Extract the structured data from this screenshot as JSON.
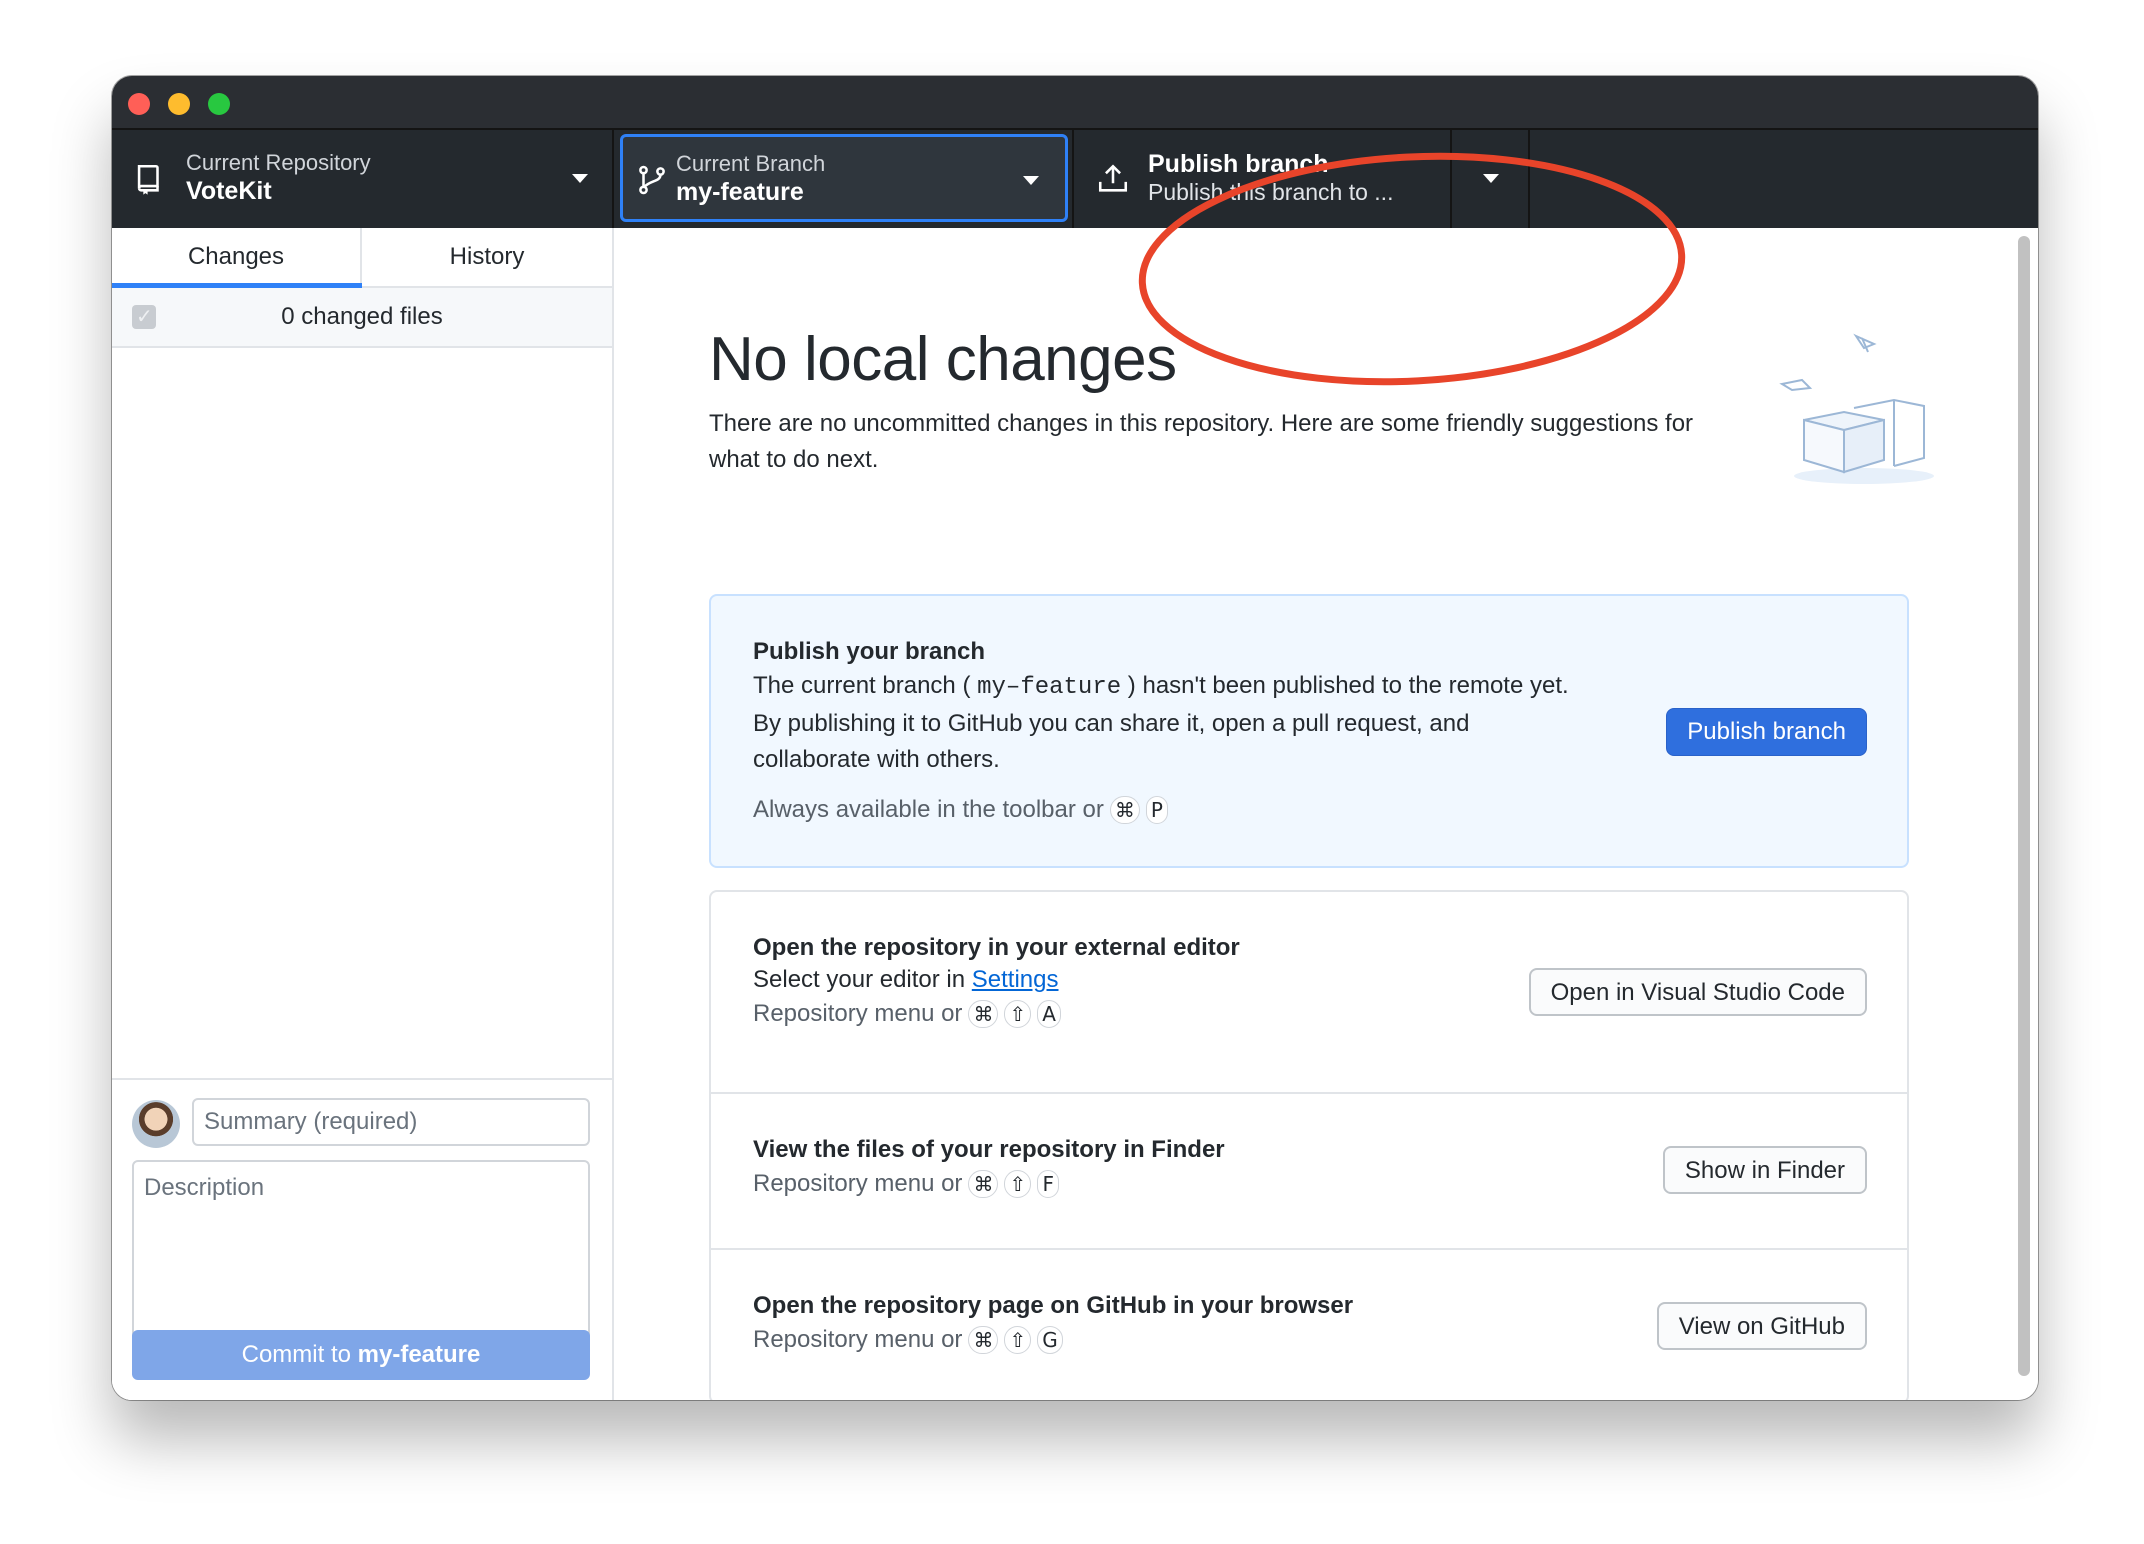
{
  "window": {
    "controls": [
      "close",
      "minimize",
      "zoom"
    ]
  },
  "toolbar": {
    "repository": {
      "label": "Current Repository",
      "value": "VoteKit",
      "icon": "repo-icon"
    },
    "branch": {
      "label": "Current Branch",
      "value": "my-feature",
      "icon": "git-branch-icon"
    },
    "publish": {
      "label": "Publish branch",
      "subtitle": "Publish this branch to ...",
      "icon": "upload-icon"
    }
  },
  "sidebar": {
    "tabs": [
      {
        "label": "Changes",
        "selected": true
      },
      {
        "label": "History",
        "selected": false
      }
    ],
    "changed_files": "0 changed files",
    "summary_placeholder": "Summary (required)",
    "description_placeholder": "Description",
    "commit": {
      "prefix": "Commit to ",
      "branch": "my-feature"
    }
  },
  "main": {
    "title": "No local changes",
    "intro": "There are no uncommitted changes in this repository. Here are some friendly suggestions for what to do next.",
    "publish_card": {
      "title": "Publish your branch",
      "text_before": "The current branch ( ",
      "branch": "my–feature",
      "text_after": " ) hasn't been published to the remote yet. By publishing it to GitHub you can share it, open a pull request, and collaborate with others.",
      "hint": "Always available in the toolbar or",
      "keys": [
        "⌘",
        "P"
      ],
      "button": "Publish branch"
    },
    "suggestions": [
      {
        "title": "Open the repository in your external editor",
        "subtitle_prefix": "Select your editor in ",
        "subtitle_link": "Settings",
        "hint": "Repository menu or",
        "keys": [
          "⌘",
          "⇧",
          "A"
        ],
        "button": "Open in Visual Studio Code"
      },
      {
        "title": "View the files of your repository in Finder",
        "hint": "Repository menu or",
        "keys": [
          "⌘",
          "⇧",
          "F"
        ],
        "button": "Show in Finder"
      },
      {
        "title": "Open the repository page on GitHub in your browser",
        "hint": "Repository menu or",
        "keys": [
          "⌘",
          "⇧",
          "G"
        ],
        "button": "View on GitHub"
      }
    ]
  },
  "colors": {
    "toolbar_bg": "#24292e",
    "accent": "#2f81f7",
    "primary_button": "#2f6fde",
    "commit_button_disabled": "#7fa6e8",
    "annotation": "#e8442a"
  }
}
